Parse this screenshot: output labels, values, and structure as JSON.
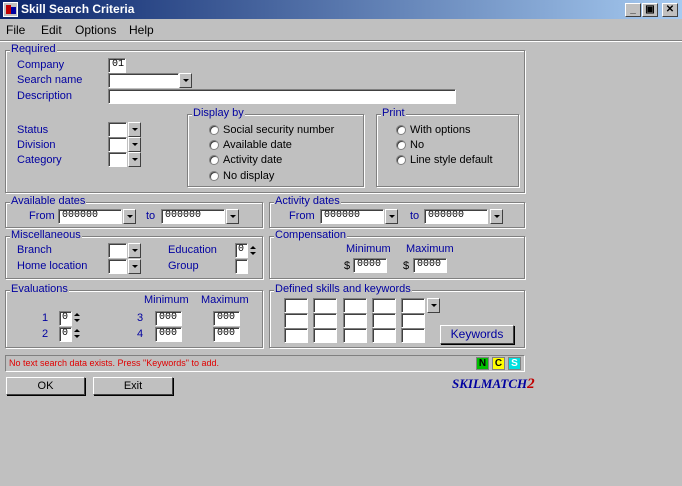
{
  "window": {
    "title": "Skill Search Criteria",
    "minimize": "_",
    "maximize": "▣",
    "close": "✕"
  },
  "menu": [
    "File",
    "Edit",
    "Options",
    "Help"
  ],
  "required": {
    "legend": "Required",
    "company_label": "Company",
    "company_value": "01",
    "search_name_label": "Search name",
    "search_name_value": "",
    "description_label": "Description",
    "description_value": "",
    "status_label": "Status",
    "division_label": "Division",
    "category_label": "Category",
    "display_by": {
      "legend": "Display by",
      "options": [
        "Social security number",
        "Available date",
        "Activity date",
        "No display"
      ]
    },
    "print": {
      "legend": "Print",
      "options": [
        "With options",
        "No",
        "Line style default"
      ]
    }
  },
  "available_dates": {
    "legend": "Available dates",
    "from_label": "From",
    "from_value": "000000",
    "to_label": "to",
    "to_value": "000000"
  },
  "activity_dates": {
    "legend": "Activity dates",
    "from_label": "From",
    "from_value": "000000",
    "to_label": "to",
    "to_value": "000000"
  },
  "miscellaneous": {
    "legend": "Miscellaneous",
    "branch_label": "Branch",
    "home_location_label": "Home location",
    "education_label": "Education",
    "education_value": "0",
    "group_label": "Group"
  },
  "compensation": {
    "legend": "Compensation",
    "minimum_label": "Minimum",
    "maximum_label": "Maximum",
    "currency": "$",
    "minimum_value": "0000",
    "maximum_value": "0000"
  },
  "evaluations": {
    "legend": "Evaluations",
    "minimum_label": "Minimum",
    "maximum_label": "Maximum",
    "rows": [
      {
        "num": "1",
        "value": "0"
      },
      {
        "num": "2",
        "value": "0"
      }
    ],
    "ranges": [
      {
        "num": "3",
        "minimum": "000",
        "maximum": "000"
      },
      {
        "num": "4",
        "minimum": "000",
        "maximum": "000"
      }
    ]
  },
  "skills": {
    "legend": "Defined skills and keywords",
    "keywords_button": "Keywords"
  },
  "status": {
    "message": "No text search data exists. Press \"Keywords\" to add.",
    "indicators": [
      "N",
      "C",
      "S"
    ],
    "indicator_colors": [
      "#00c000",
      "#ffff00",
      "#00e0e0"
    ]
  },
  "buttons": {
    "ok": "OK",
    "exit": "Exit"
  },
  "logo": {
    "text": "SKILMATCH",
    "number": "2"
  }
}
